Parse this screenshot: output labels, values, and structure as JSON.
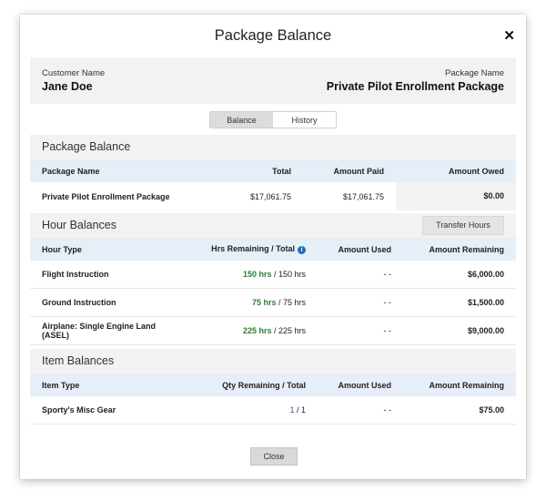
{
  "modal": {
    "title": "Package Balance",
    "close_glyph": "✕"
  },
  "customer": {
    "name_label": "Customer Name",
    "name_value": "Jane Doe",
    "package_label": "Package Name",
    "package_value": "Private Pilot Enrollment Package"
  },
  "tabs": [
    {
      "label": "Balance",
      "active": true
    },
    {
      "label": "History",
      "active": false
    }
  ],
  "package_balance": {
    "heading": "Package Balance",
    "columns": [
      "Package Name",
      "Total",
      "Amount Paid",
      "Amount Owed"
    ],
    "row": {
      "name": "Private Pilot Enrollment Package",
      "total": "$17,061.75",
      "paid": "$17,061.75",
      "owed": "$0.00"
    }
  },
  "hour_balances": {
    "heading": "Hour Balances",
    "transfer_button": "Transfer Hours",
    "columns": [
      "Hour Type",
      "Hrs Remaining / Total",
      "Amount Used",
      "Amount Remaining"
    ],
    "info_icon": "i",
    "rows": [
      {
        "type": "Flight Instruction",
        "remaining": "150 hrs",
        "total": " / 150 hrs",
        "used": "- -",
        "amount_remaining": "$6,000.00"
      },
      {
        "type": "Ground Instruction",
        "remaining": "75 hrs",
        "total": " / 75 hrs",
        "used": "- -",
        "amount_remaining": "$1,500.00"
      },
      {
        "type": "Airplane: Single Engine Land (ASEL)",
        "remaining": "225 hrs",
        "total": " / 225 hrs",
        "used": "- -",
        "amount_remaining": "$9,000.00"
      }
    ]
  },
  "item_balances": {
    "heading": "Item Balances",
    "columns": [
      "Item Type",
      "Qty Remaining / Total",
      "Amount Used",
      "Amount Remaining"
    ],
    "rows": [
      {
        "type": "Sporty's Misc Gear",
        "remaining": "1",
        "total": " / 1",
        "used": "- -",
        "amount_remaining": "$75.00"
      }
    ]
  },
  "footer": {
    "close_label": "Close"
  },
  "colors": {
    "accent_green": "#2e7d32",
    "accent_blue": "#1f5fa0",
    "header_row_bg": "#e6eef7",
    "section_bg": "#f2f2f2"
  }
}
